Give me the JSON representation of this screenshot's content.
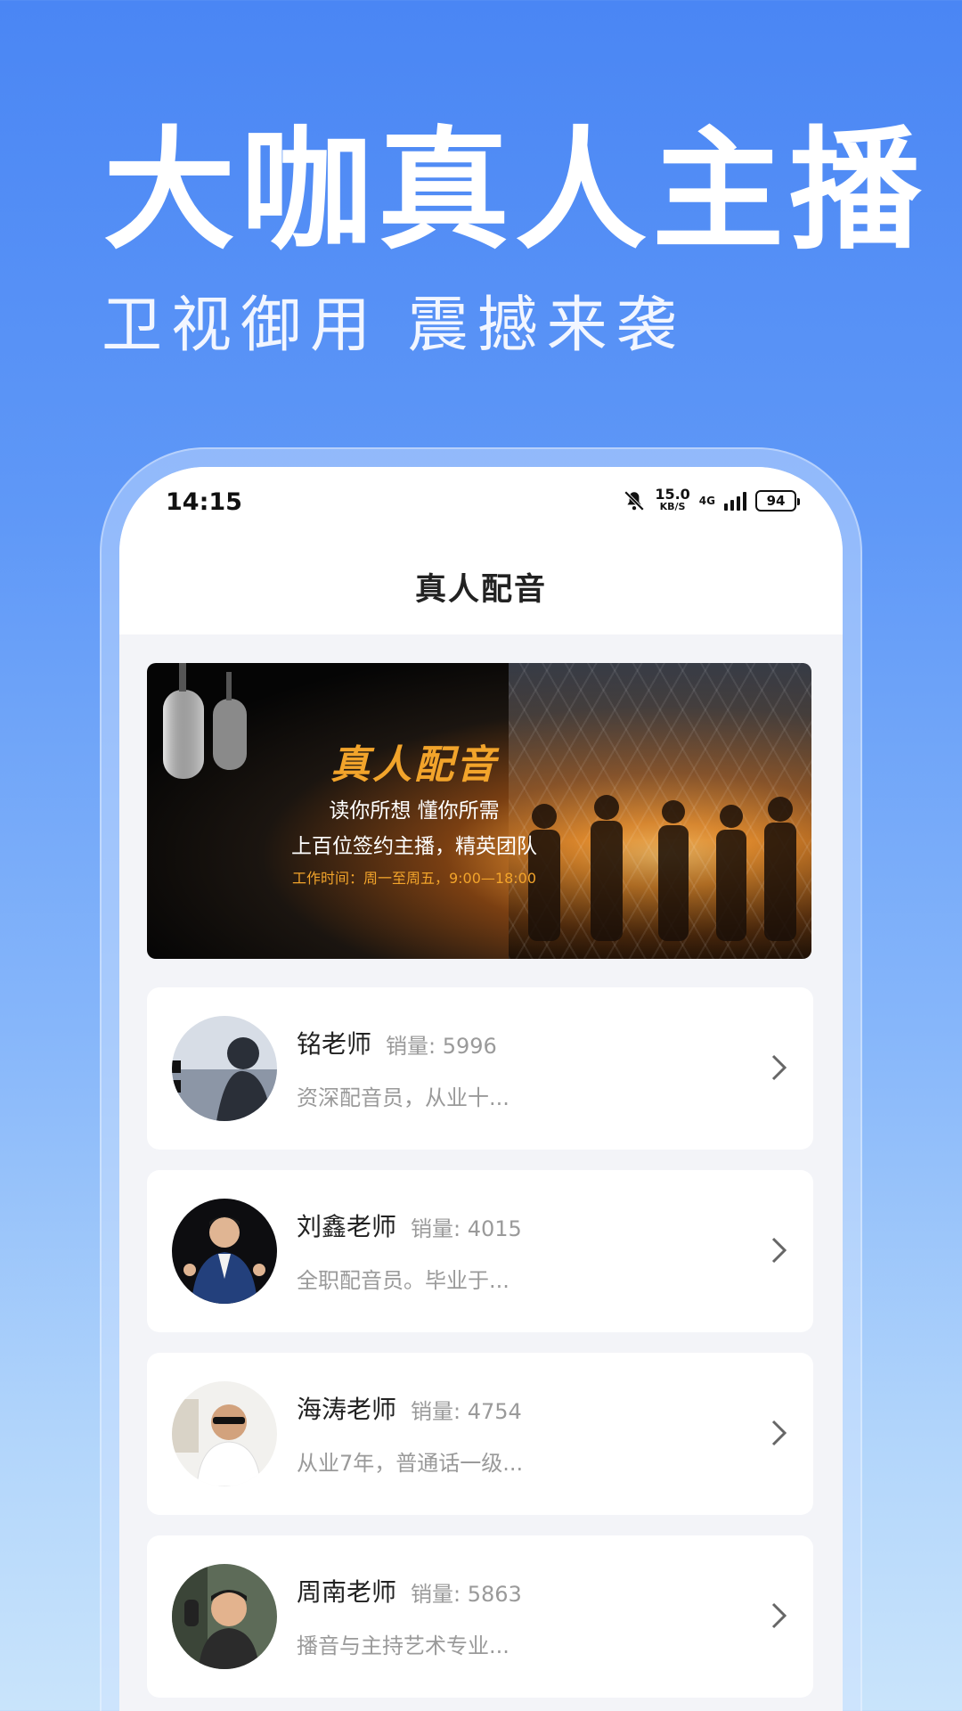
{
  "promo": {
    "title": "大咖真人主播",
    "subtitle": "卫视御用 震撼来袭"
  },
  "status_bar": {
    "time": "14:15",
    "speed_value": "15.0",
    "speed_unit": "KB/S",
    "network": "4G",
    "battery": "94",
    "icons": [
      "mute-bell-icon",
      "signal-icon",
      "battery-icon"
    ]
  },
  "header": {
    "title": "真人配音"
  },
  "banner": {
    "title": "真人配音",
    "line1": "读你所想 懂你所需",
    "line2": "上百位签约主播，精英团队",
    "line3": "工作时间：周一至周五，9:00—18:00"
  },
  "teachers": [
    {
      "name": "铭老师",
      "sales": "销量: 5996",
      "desc": "资深配音员，从业十..."
    },
    {
      "name": "刘鑫老师",
      "sales": "销量: 4015",
      "desc": "全职配音员。毕业于..."
    },
    {
      "name": "海涛老师",
      "sales": "销量: 4754",
      "desc": "从业7年，普通话一级..."
    },
    {
      "name": "周南老师",
      "sales": "销量: 5863",
      "desc": "播音与主持艺术专业..."
    }
  ],
  "colors": {
    "background_top": "#4a86f4",
    "background_bottom": "#c9e4fb",
    "banner_accent": "#f2a42b",
    "muted_text": "#9a9a9a"
  }
}
